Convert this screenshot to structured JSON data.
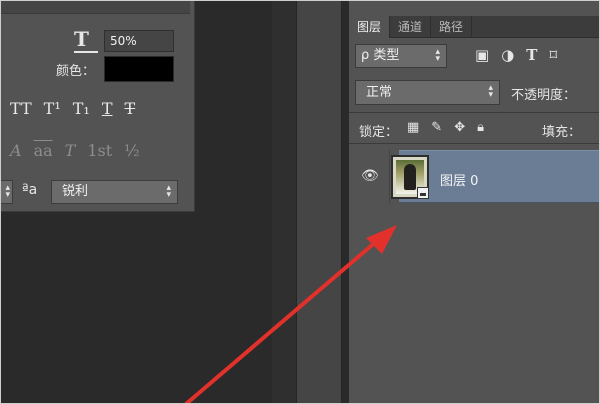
{
  "character": {
    "scale_value": "50%",
    "color_label": "颜色：",
    "style_buttons": [
      "TT",
      "T¹",
      "T₁",
      "T",
      "T"
    ],
    "opentype_buttons": [
      "A",
      "aa",
      "T",
      "1st",
      "½"
    ],
    "aa_icon": "ªa",
    "aa_method": "锐利"
  },
  "layers": {
    "tabs": [
      "图层",
      "通道",
      "路径"
    ],
    "filter": "ρ 类型",
    "filter_icons": [
      "image-filter-icon",
      "adjustment-filter-icon",
      "type-filter-icon",
      "shape-filter-icon"
    ],
    "blend_mode": "正常",
    "opacity_label": "不透明度：",
    "lock_label": "锁定：",
    "fill_label": "填充：",
    "layer_name": "图层 0"
  },
  "colors": {
    "panel_bg": "#535353",
    "selected_layer": "#6a7d94",
    "arrow": "#e2312b"
  }
}
